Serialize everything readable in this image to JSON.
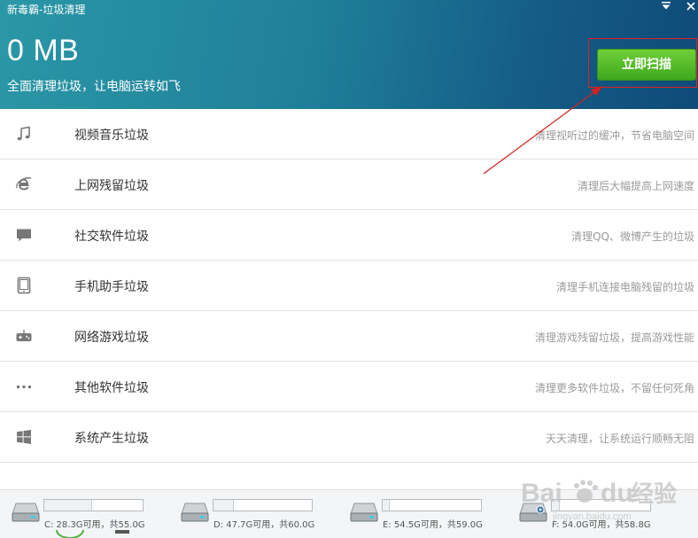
{
  "window": {
    "title": "新毒霸-垃圾清理",
    "menu_icon": "dropdown-triangle-icon",
    "close_icon": "close-icon"
  },
  "header": {
    "size_text": "0 MB",
    "tagline": "全面清理垃圾，让电脑运转如飞",
    "scan_button": "立即扫描",
    "accent_color": "#4caf25",
    "highlight_color": "#e02020"
  },
  "categories": [
    {
      "icon": "music-note-icon",
      "label": "视频音乐垃圾",
      "desc": "清理视听过的缓冲，节省电脑空间"
    },
    {
      "icon": "internet-explorer-icon",
      "label": "上网残留垃圾",
      "desc": "清理后大幅提高上网速度"
    },
    {
      "icon": "chat-bubble-icon",
      "label": "社交软件垃圾",
      "desc": "清理QQ、微博产生的垃圾"
    },
    {
      "icon": "tablet-icon",
      "label": "手机助手垃圾",
      "desc": "清理手机连接电脑残留的垃圾"
    },
    {
      "icon": "gamepad-icon",
      "label": "网络游戏垃圾",
      "desc": "清理游戏残留垃圾，提高游戏性能"
    },
    {
      "icon": "more-dots-icon",
      "label": "其他软件垃圾",
      "desc": "清理更多软件垃圾，不留任何死角"
    },
    {
      "icon": "windows-logo-icon",
      "label": "系统产生垃圾",
      "desc": "天天清理，让系统运行顺畅无阻"
    }
  ],
  "drives": [
    {
      "icon": "hard-drive-icon",
      "text": "C: 28.3G可用，共55.0G",
      "free": 28.3,
      "total": 55.0
    },
    {
      "icon": "hard-drive-icon",
      "text": "D: 47.7G可用，共60.0G",
      "free": 47.7,
      "total": 60.0
    },
    {
      "icon": "hard-drive-icon",
      "text": "E: 54.5G可用，共59.0G",
      "free": 54.5,
      "total": 59.0
    },
    {
      "icon": "removable-drive-icon",
      "text": "F: 54.0G可用，共58.8G",
      "free": 54.0,
      "total": 58.8
    }
  ],
  "watermark": {
    "text": "Baidu经验",
    "url": "jingyan.baidu.com"
  }
}
